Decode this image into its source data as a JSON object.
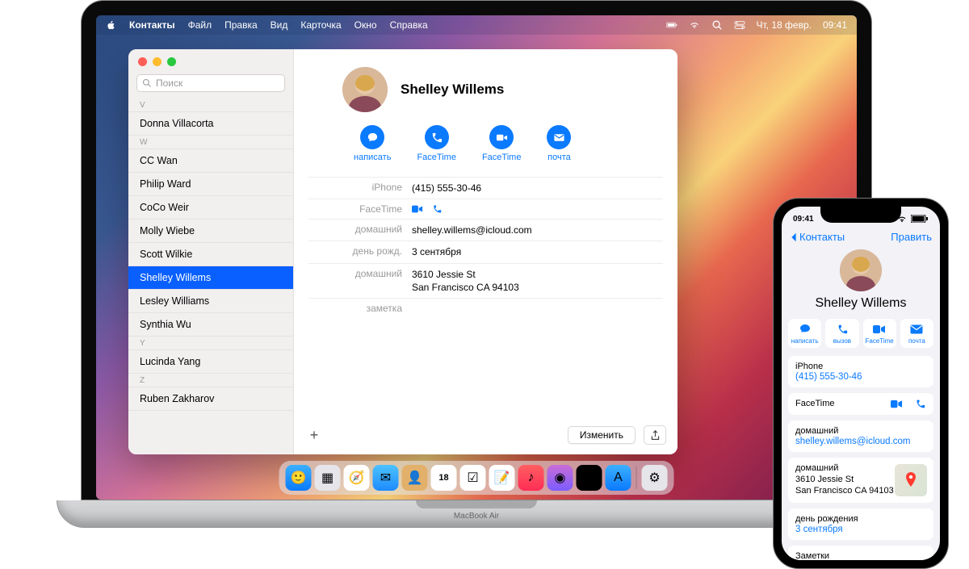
{
  "menubar": {
    "app": "Контакты",
    "items": [
      "Файл",
      "Правка",
      "Вид",
      "Карточка",
      "Окно",
      "Справка"
    ],
    "date": "Чт, 18 февр.",
    "time": "09:41"
  },
  "search": {
    "placeholder": "Поиск"
  },
  "sections": [
    {
      "letter": "V",
      "contacts": [
        "Donna Villacorta"
      ]
    },
    {
      "letter": "W",
      "contacts": [
        "CC Wan",
        "Philip Ward",
        "CoCo Weir",
        "Molly Wiebe",
        "Scott Wilkie",
        "Shelley Willems",
        "Lesley Williams",
        "Synthia Wu"
      ]
    },
    {
      "letter": "Y",
      "contacts": [
        "Lucinda Yang"
      ]
    },
    {
      "letter": "Z",
      "contacts": [
        "Ruben Zakharov"
      ]
    }
  ],
  "selected_contact": "Shelley Willems",
  "detail": {
    "name": "Shelley Willems",
    "actions": {
      "message": "написать",
      "audio": "FaceTime",
      "video": "FaceTime",
      "mail": "почта"
    },
    "fields": {
      "iphone_label": "iPhone",
      "iphone_value": "(415) 555-30-46",
      "facetime_label": "FaceTime",
      "email_label": "домашний",
      "email_value": "shelley.willems@icloud.com",
      "birthday_label": "день рожд.",
      "birthday_value": "3 сентября",
      "address_label": "домашний",
      "address_line1": "3610 Jessie St",
      "address_line2": "San Francisco CA 94103",
      "note_label": "заметка"
    },
    "edit_button": "Изменить"
  },
  "macbook_brand": "MacBook Air",
  "iphone": {
    "status_time": "09:41",
    "back": "Контакты",
    "edit": "Править",
    "name": "Shelley Willems",
    "actions": {
      "message": "написать",
      "call": "вызов",
      "facetime": "FaceTime",
      "mail": "почта"
    },
    "phone_label": "iPhone",
    "phone_value": "(415) 555-30-46",
    "ft_label": "FaceTime",
    "email_label": "домашний",
    "email_value": "shelley.willems@icloud.com",
    "addr_label": "домашний",
    "addr_line1": "3610 Jessie St",
    "addr_line2": "San Francisco CA 94103",
    "bday_label": "день рождения",
    "bday_value": "3 сентября",
    "notes_label": "Заметки"
  },
  "dock_apps": [
    {
      "name": "finder",
      "bg": "linear-gradient(#3bb0ff,#0a7aff)",
      "glyph": "🙂"
    },
    {
      "name": "launchpad",
      "bg": "#e5e5ea",
      "glyph": "▦"
    },
    {
      "name": "safari",
      "bg": "#fff",
      "glyph": "🧭"
    },
    {
      "name": "mail",
      "bg": "linear-gradient(#4cc2ff,#1e8bff)",
      "glyph": "✉︎"
    },
    {
      "name": "contacts",
      "bg": "#e2b06a",
      "glyph": "👤"
    },
    {
      "name": "calendar",
      "bg": "#fff",
      "glyph": "18"
    },
    {
      "name": "reminders",
      "bg": "#fff",
      "glyph": "☑︎"
    },
    {
      "name": "notes",
      "bg": "#fff",
      "glyph": "📝"
    },
    {
      "name": "music",
      "bg": "linear-gradient(#ff5e62,#ff2d55)",
      "glyph": "♪"
    },
    {
      "name": "podcasts",
      "bg": "linear-gradient(#c86dd7,#7b5cff)",
      "glyph": "◉"
    },
    {
      "name": "tv",
      "bg": "#000",
      "glyph": "▶︎"
    },
    {
      "name": "appstore",
      "bg": "linear-gradient(#3bb0ff,#0a7aff)",
      "glyph": "A"
    },
    {
      "name": "settings",
      "bg": "#e5e5ea",
      "glyph": "⚙︎"
    }
  ]
}
